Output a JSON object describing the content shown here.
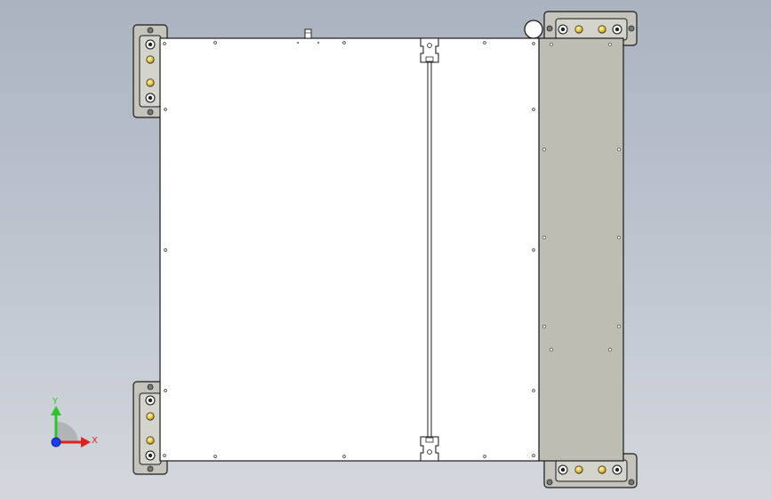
{
  "view": {
    "background_top": "#aab3c0",
    "background_bottom": "#d3d7dd"
  },
  "model": {
    "panel_color": "#ffffff",
    "rail_color": "#bdbdb1",
    "bracket_color": "#c4c4bc",
    "edge_color": "#1a1a1a",
    "bolt_color": "#e8c23a"
  },
  "triad": {
    "x_label": "X",
    "y_label": "Y",
    "x_color": "#e0201a",
    "y_color": "#2ec22e",
    "z_color": "#1a3cf0"
  }
}
